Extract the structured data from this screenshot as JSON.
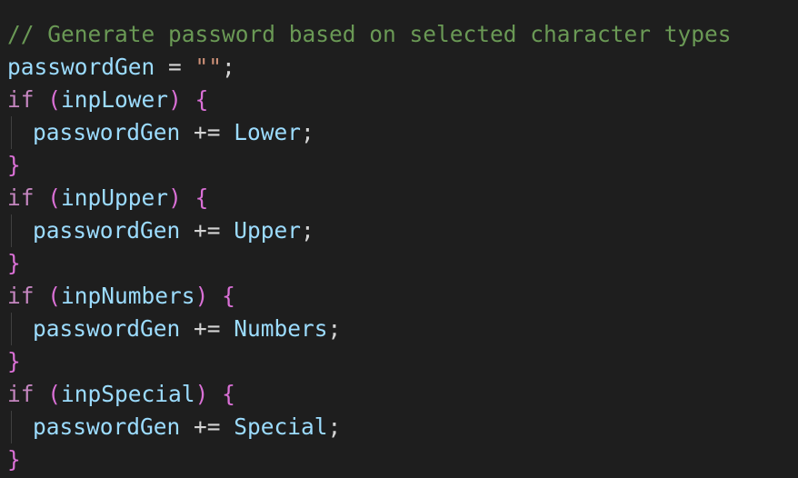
{
  "code": {
    "comment": "// Generate password based on selected character types",
    "init": {
      "var": "passwordGen",
      "op": " = ",
      "value": "\"\"",
      "end": ";"
    },
    "blocks": [
      {
        "keyword": "if",
        "space": " ",
        "open_paren": "(",
        "condition": "inpLower",
        "close_paren": ")",
        "open_brace": " {",
        "target": "passwordGen",
        "op": " += ",
        "source": "Lower",
        "end": ";",
        "close_brace": "}"
      },
      {
        "keyword": "if",
        "space": " ",
        "open_paren": "(",
        "condition": "inpUpper",
        "close_paren": ")",
        "open_brace": " {",
        "target": "passwordGen",
        "op": " += ",
        "source": "Upper",
        "end": ";",
        "close_brace": "}"
      },
      {
        "keyword": "if",
        "space": " ",
        "open_paren": "(",
        "condition": "inpNumbers",
        "close_paren": ")",
        "open_brace": " {",
        "target": "passwordGen",
        "op": " += ",
        "source": "Numbers",
        "end": ";",
        "close_brace": "}"
      },
      {
        "keyword": "if",
        "space": " ",
        "open_paren": "(",
        "condition": "inpSpecial",
        "close_paren": ")",
        "open_brace": " {",
        "target": "passwordGen",
        "op": " += ",
        "source": "Special",
        "end": ";",
        "close_brace": "}"
      }
    ]
  }
}
